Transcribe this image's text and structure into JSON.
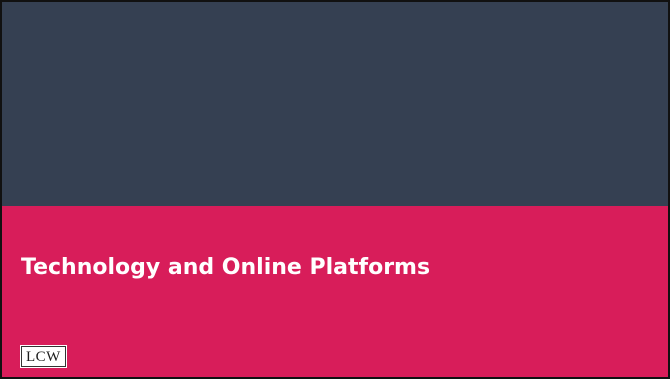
{
  "slide": {
    "title": "Technology and Online Platforms",
    "logo_text": "LCW"
  },
  "colors": {
    "top_band": "#354052",
    "bottom_band": "#d81d5a",
    "title_text": "#ffffff",
    "border": "#111111"
  }
}
